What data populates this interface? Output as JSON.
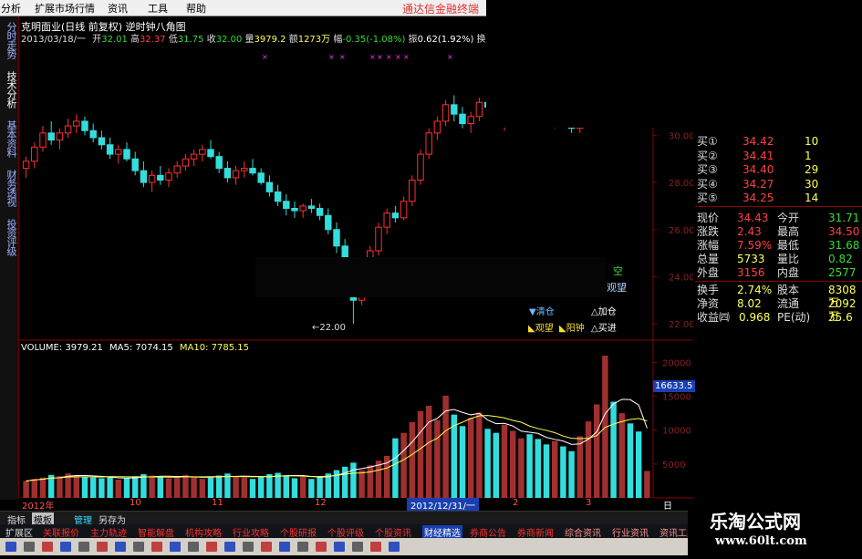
{
  "menu": {
    "items": [
      "分析",
      "扩展市场行情",
      "资讯",
      "工具",
      "帮助"
    ],
    "brand": "通达信金融终端"
  },
  "left_tabs": [
    "分时走势",
    "技术分析",
    "基本资料",
    "财务透视",
    "投资评级"
  ],
  "header": {
    "title": "克明面业(日线 前复权) 逆时钟八角图",
    "date": "2013/03/18/一",
    "open_label": "开",
    "open": "32.01",
    "high_label": "高",
    "high": "32.37",
    "low_label": "低",
    "low": "31.75",
    "close_label": "收",
    "close": "32.00",
    "vol_label": "量",
    "vol": "3979.2",
    "amount_label": "额",
    "amount": "1273万",
    "change_label": "幅",
    "change": "-0.35(-1.08%)",
    "amp_label": "振",
    "amp": "0.62(1.92%)",
    "turn_label": "换1"
  },
  "price_axis": [
    "32.00",
    "30.00",
    "28.00",
    "26.00",
    "24.00",
    "22.00"
  ],
  "volume_axis": [
    "20000",
    "15000",
    "10000",
    "5000"
  ],
  "volume_highlight": "16633.5",
  "low_marker": "←22.00",
  "volume_info": {
    "vol_label": "VOLUME:",
    "vol": "3979.21",
    "ma5_label": "MA5:",
    "ma5": "7074.15",
    "ma10_label": "MA10:",
    "ma10": "7785.15"
  },
  "legend": {
    "kong": "空",
    "guanwang_short": "观望",
    "qingcang": "▼清仓",
    "jiacang": "△加仓",
    "guanwang": "◣观望",
    "yangzhong": "◣阳钟",
    "maijin": "△买进"
  },
  "quote": {
    "bids": [
      {
        "label": "买①",
        "price": "34.42",
        "qty": "10"
      },
      {
        "label": "买②",
        "price": "34.41",
        "qty": "1"
      },
      {
        "label": "买③",
        "price": "34.40",
        "qty": "29"
      },
      {
        "label": "买④",
        "price": "34.27",
        "qty": "30"
      },
      {
        "label": "买⑤",
        "price": "34.25",
        "qty": "14"
      }
    ],
    "rows": [
      {
        "l1": "现价",
        "v1": "34.43",
        "l2": "今开",
        "v2": "31.71",
        "c1": "#ff4040",
        "c2": "#33dd33"
      },
      {
        "l1": "涨跌",
        "v1": "2.43",
        "l2": "最高",
        "v2": "34.50",
        "c1": "#ff4040",
        "c2": "#ff4040"
      },
      {
        "l1": "涨幅",
        "v1": "7.59%",
        "l2": "最低",
        "v2": "31.68",
        "c1": "#ff4040",
        "c2": "#33dd33"
      },
      {
        "l1": "总量",
        "v1": "5733",
        "l2": "量比",
        "v2": "0.82",
        "c1": "#ffff55",
        "c2": "#33dd33"
      },
      {
        "l1": "外盘",
        "v1": "3156",
        "l2": "内盘",
        "v2": "2577",
        "c1": "#ff4040",
        "c2": "#33dd33"
      },
      {
        "l1": "换手",
        "v1": "2.74%",
        "l2": "股本",
        "v2": "8308万",
        "c1": "#ffff55",
        "c2": "#ffff55"
      },
      {
        "l1": "净资",
        "v1": "8.02",
        "l2": "流通",
        "v2": "2092万",
        "c1": "#ffff55",
        "c2": "#ffff55"
      },
      {
        "l1": "收益㈣",
        "v1": "0.968",
        "l2": "PE(动)",
        "v2": "35.6",
        "c1": "#ffff55",
        "c2": "#ffff55"
      }
    ]
  },
  "time_axis": {
    "labels": [
      "2012年",
      "10",
      "11",
      "12",
      "2012/12/31/一",
      "2",
      "3"
    ],
    "period": "日线"
  },
  "tabs": [
    "指标",
    "模板",
    "管理",
    "另存为"
  ],
  "func_items": [
    "扩展区",
    "关联报价",
    "主力轨迹",
    "智能解盘",
    "机构攻略",
    "行业攻略",
    "个股研报",
    "个股评级",
    "个股资讯",
    "财经精选",
    "券商公告",
    "券商新闻",
    "综合资讯",
    "行业资讯",
    "资讯工具"
  ],
  "logo": {
    "title": "乐淘公式网",
    "url": "www.60lt.com"
  },
  "chart_data": {
    "type": "candlestick",
    "price_ylim": [
      21.5,
      33.5
    ],
    "volume_ylim": [
      0,
      21000
    ],
    "note": "daily candles read approximately from the chart",
    "candles": [
      [
        28.6,
        29.1,
        28.2,
        28.9
      ],
      [
        28.9,
        29.7,
        28.6,
        29.5
      ],
      [
        29.5,
        30.4,
        29.3,
        30.1
      ],
      [
        30.1,
        30.6,
        29.6,
        29.8
      ],
      [
        29.8,
        30.3,
        29.4,
        30.1
      ],
      [
        30.1,
        30.7,
        29.9,
        30.4
      ],
      [
        30.4,
        30.9,
        30.1,
        30.6
      ],
      [
        30.6,
        30.8,
        30.0,
        30.2
      ],
      [
        30.2,
        30.5,
        29.7,
        29.9
      ],
      [
        29.9,
        30.2,
        29.4,
        29.6
      ],
      [
        29.6,
        29.9,
        29.0,
        29.2
      ],
      [
        29.2,
        29.6,
        28.8,
        29.4
      ],
      [
        29.4,
        29.7,
        28.9,
        29.0
      ],
      [
        29.0,
        29.3,
        28.3,
        28.5
      ],
      [
        28.5,
        28.9,
        27.8,
        28.0
      ],
      [
        28.0,
        28.5,
        27.6,
        28.3
      ],
      [
        28.3,
        28.7,
        27.9,
        28.1
      ],
      [
        28.1,
        28.6,
        27.8,
        28.4
      ],
      [
        28.4,
        28.9,
        28.2,
        28.7
      ],
      [
        28.7,
        29.2,
        28.5,
        29.0
      ],
      [
        29.0,
        29.4,
        28.7,
        29.2
      ],
      [
        29.2,
        29.6,
        28.9,
        29.4
      ],
      [
        29.4,
        29.8,
        29.0,
        29.1
      ],
      [
        29.1,
        29.3,
        28.4,
        28.6
      ],
      [
        28.6,
        28.9,
        28.0,
        28.2
      ],
      [
        28.2,
        28.7,
        27.9,
        28.5
      ],
      [
        28.5,
        28.9,
        28.2,
        28.6
      ],
      [
        28.6,
        29.0,
        28.3,
        28.4
      ],
      [
        28.4,
        28.6,
        27.9,
        28.0
      ],
      [
        28.0,
        28.3,
        27.4,
        27.6
      ],
      [
        27.6,
        27.9,
        27.0,
        27.2
      ],
      [
        27.2,
        27.5,
        26.6,
        26.9
      ],
      [
        26.9,
        27.2,
        26.5,
        26.8
      ],
      [
        26.8,
        27.1,
        26.5,
        27.0
      ],
      [
        27.0,
        27.3,
        26.7,
        26.9
      ],
      [
        26.9,
        27.1,
        26.4,
        26.6
      ],
      [
        26.6,
        26.9,
        25.8,
        26.0
      ],
      [
        26.0,
        26.3,
        25.0,
        25.3
      ],
      [
        25.3,
        25.6,
        24.2,
        24.5
      ],
      [
        24.5,
        24.8,
        22.0,
        23.0
      ],
      [
        23.0,
        24.5,
        22.8,
        24.2
      ],
      [
        24.2,
        25.3,
        24.0,
        25.1
      ],
      [
        25.1,
        26.3,
        24.9,
        26.1
      ],
      [
        26.1,
        26.9,
        25.8,
        26.7
      ],
      [
        26.7,
        27.0,
        26.3,
        26.5
      ],
      [
        26.5,
        27.4,
        26.4,
        27.2
      ],
      [
        27.2,
        28.3,
        27.0,
        28.1
      ],
      [
        28.1,
        29.4,
        27.9,
        29.2
      ],
      [
        29.2,
        30.3,
        29.0,
        30.1
      ],
      [
        30.1,
        30.8,
        29.8,
        30.6
      ],
      [
        30.6,
        31.5,
        30.4,
        31.3
      ],
      [
        31.3,
        31.7,
        30.6,
        30.9
      ],
      [
        30.9,
        31.2,
        30.3,
        30.5
      ],
      [
        30.5,
        31.0,
        30.1,
        30.8
      ],
      [
        30.8,
        31.6,
        30.6,
        31.4
      ],
      [
        31.4,
        31.9,
        31.0,
        31.2
      ],
      [
        31.2,
        31.5,
        30.5,
        30.7
      ],
      [
        30.7,
        31.0,
        30.2,
        30.9
      ],
      [
        30.9,
        31.8,
        30.7,
        31.6
      ],
      [
        31.6,
        32.4,
        31.4,
        32.2
      ],
      [
        32.2,
        32.6,
        31.5,
        31.7
      ],
      [
        31.7,
        31.9,
        30.9,
        31.1
      ],
      [
        31.1,
        31.4,
        30.5,
        30.7
      ],
      [
        30.7,
        31.0,
        30.3,
        30.8
      ],
      [
        30.8,
        31.1,
        30.4,
        30.6
      ],
      [
        30.6,
        30.9,
        30.1,
        30.3
      ],
      [
        30.3,
        31.2,
        30.1,
        31.0
      ],
      [
        31.0,
        31.7,
        30.8,
        31.5
      ],
      [
        31.5,
        32.3,
        31.3,
        32.1
      ],
      [
        32.1,
        33.2,
        31.9,
        33.0
      ],
      [
        33.0,
        33.4,
        32.3,
        32.6
      ],
      [
        32.6,
        33.3,
        32.4,
        33.1
      ],
      [
        33.1,
        33.4,
        32.5,
        32.7
      ],
      [
        32.7,
        33.0,
        31.7,
        31.9
      ],
      [
        31.9,
        32.37,
        31.75,
        32.0
      ]
    ],
    "volumes": [
      2500,
      2800,
      3000,
      3400,
      3200,
      3600,
      3300,
      3100,
      3000,
      2900,
      3100,
      2700,
      2900,
      3200,
      3500,
      3300,
      3100,
      2900,
      3000,
      3400,
      3100,
      2800,
      3000,
      3300,
      3600,
      3200,
      3000,
      2800,
      3100,
      3500,
      3700,
      3300,
      2900,
      3100,
      2800,
      3200,
      3600,
      4100,
      4600,
      5200,
      4100,
      4800,
      5500,
      6200,
      8800,
      9600,
      11200,
      12800,
      13600,
      11500,
      15100,
      12300,
      10600,
      11800,
      12600,
      10200,
      9600,
      10800,
      9900,
      8800,
      9400,
      8700,
      7900,
      8400,
      7600,
      6900,
      9100,
      11300,
      13800,
      21000,
      14200,
      12500,
      11000,
      9800,
      3979
    ]
  }
}
